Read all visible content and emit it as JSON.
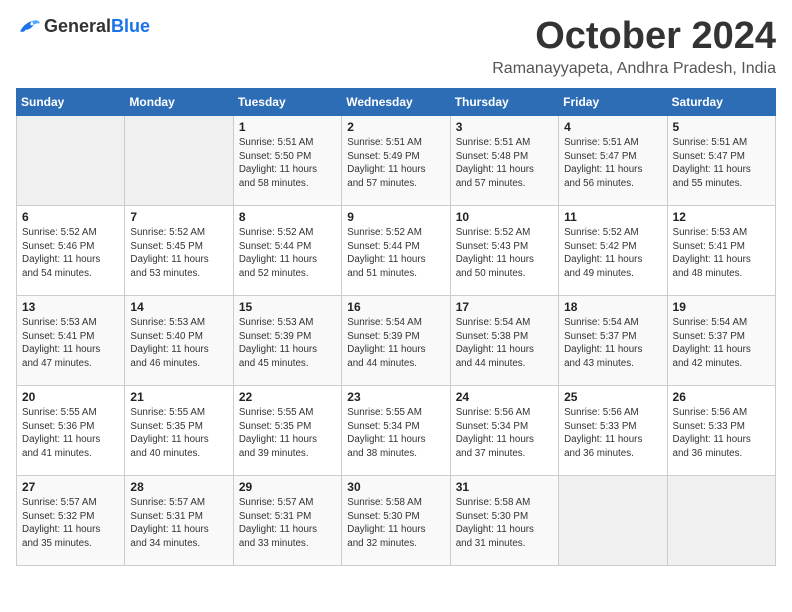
{
  "logo": {
    "general": "General",
    "blue": "Blue"
  },
  "header": {
    "month": "October 2024",
    "location": "Ramanayyapeta, Andhra Pradesh, India"
  },
  "weekdays": [
    "Sunday",
    "Monday",
    "Tuesday",
    "Wednesday",
    "Thursday",
    "Friday",
    "Saturday"
  ],
  "weeks": [
    [
      {
        "day": "",
        "sunrise": "",
        "sunset": "",
        "daylight": ""
      },
      {
        "day": "",
        "sunrise": "",
        "sunset": "",
        "daylight": ""
      },
      {
        "day": "1",
        "sunrise": "Sunrise: 5:51 AM",
        "sunset": "Sunset: 5:50 PM",
        "daylight": "Daylight: 11 hours and 58 minutes."
      },
      {
        "day": "2",
        "sunrise": "Sunrise: 5:51 AM",
        "sunset": "Sunset: 5:49 PM",
        "daylight": "Daylight: 11 hours and 57 minutes."
      },
      {
        "day": "3",
        "sunrise": "Sunrise: 5:51 AM",
        "sunset": "Sunset: 5:48 PM",
        "daylight": "Daylight: 11 hours and 57 minutes."
      },
      {
        "day": "4",
        "sunrise": "Sunrise: 5:51 AM",
        "sunset": "Sunset: 5:47 PM",
        "daylight": "Daylight: 11 hours and 56 minutes."
      },
      {
        "day": "5",
        "sunrise": "Sunrise: 5:51 AM",
        "sunset": "Sunset: 5:47 PM",
        "daylight": "Daylight: 11 hours and 55 minutes."
      }
    ],
    [
      {
        "day": "6",
        "sunrise": "Sunrise: 5:52 AM",
        "sunset": "Sunset: 5:46 PM",
        "daylight": "Daylight: 11 hours and 54 minutes."
      },
      {
        "day": "7",
        "sunrise": "Sunrise: 5:52 AM",
        "sunset": "Sunset: 5:45 PM",
        "daylight": "Daylight: 11 hours and 53 minutes."
      },
      {
        "day": "8",
        "sunrise": "Sunrise: 5:52 AM",
        "sunset": "Sunset: 5:44 PM",
        "daylight": "Daylight: 11 hours and 52 minutes."
      },
      {
        "day": "9",
        "sunrise": "Sunrise: 5:52 AM",
        "sunset": "Sunset: 5:44 PM",
        "daylight": "Daylight: 11 hours and 51 minutes."
      },
      {
        "day": "10",
        "sunrise": "Sunrise: 5:52 AM",
        "sunset": "Sunset: 5:43 PM",
        "daylight": "Daylight: 11 hours and 50 minutes."
      },
      {
        "day": "11",
        "sunrise": "Sunrise: 5:52 AM",
        "sunset": "Sunset: 5:42 PM",
        "daylight": "Daylight: 11 hours and 49 minutes."
      },
      {
        "day": "12",
        "sunrise": "Sunrise: 5:53 AM",
        "sunset": "Sunset: 5:41 PM",
        "daylight": "Daylight: 11 hours and 48 minutes."
      }
    ],
    [
      {
        "day": "13",
        "sunrise": "Sunrise: 5:53 AM",
        "sunset": "Sunset: 5:41 PM",
        "daylight": "Daylight: 11 hours and 47 minutes."
      },
      {
        "day": "14",
        "sunrise": "Sunrise: 5:53 AM",
        "sunset": "Sunset: 5:40 PM",
        "daylight": "Daylight: 11 hours and 46 minutes."
      },
      {
        "day": "15",
        "sunrise": "Sunrise: 5:53 AM",
        "sunset": "Sunset: 5:39 PM",
        "daylight": "Daylight: 11 hours and 45 minutes."
      },
      {
        "day": "16",
        "sunrise": "Sunrise: 5:54 AM",
        "sunset": "Sunset: 5:39 PM",
        "daylight": "Daylight: 11 hours and 44 minutes."
      },
      {
        "day": "17",
        "sunrise": "Sunrise: 5:54 AM",
        "sunset": "Sunset: 5:38 PM",
        "daylight": "Daylight: 11 hours and 44 minutes."
      },
      {
        "day": "18",
        "sunrise": "Sunrise: 5:54 AM",
        "sunset": "Sunset: 5:37 PM",
        "daylight": "Daylight: 11 hours and 43 minutes."
      },
      {
        "day": "19",
        "sunrise": "Sunrise: 5:54 AM",
        "sunset": "Sunset: 5:37 PM",
        "daylight": "Daylight: 11 hours and 42 minutes."
      }
    ],
    [
      {
        "day": "20",
        "sunrise": "Sunrise: 5:55 AM",
        "sunset": "Sunset: 5:36 PM",
        "daylight": "Daylight: 11 hours and 41 minutes."
      },
      {
        "day": "21",
        "sunrise": "Sunrise: 5:55 AM",
        "sunset": "Sunset: 5:35 PM",
        "daylight": "Daylight: 11 hours and 40 minutes."
      },
      {
        "day": "22",
        "sunrise": "Sunrise: 5:55 AM",
        "sunset": "Sunset: 5:35 PM",
        "daylight": "Daylight: 11 hours and 39 minutes."
      },
      {
        "day": "23",
        "sunrise": "Sunrise: 5:55 AM",
        "sunset": "Sunset: 5:34 PM",
        "daylight": "Daylight: 11 hours and 38 minutes."
      },
      {
        "day": "24",
        "sunrise": "Sunrise: 5:56 AM",
        "sunset": "Sunset: 5:34 PM",
        "daylight": "Daylight: 11 hours and 37 minutes."
      },
      {
        "day": "25",
        "sunrise": "Sunrise: 5:56 AM",
        "sunset": "Sunset: 5:33 PM",
        "daylight": "Daylight: 11 hours and 36 minutes."
      },
      {
        "day": "26",
        "sunrise": "Sunrise: 5:56 AM",
        "sunset": "Sunset: 5:33 PM",
        "daylight": "Daylight: 11 hours and 36 minutes."
      }
    ],
    [
      {
        "day": "27",
        "sunrise": "Sunrise: 5:57 AM",
        "sunset": "Sunset: 5:32 PM",
        "daylight": "Daylight: 11 hours and 35 minutes."
      },
      {
        "day": "28",
        "sunrise": "Sunrise: 5:57 AM",
        "sunset": "Sunset: 5:31 PM",
        "daylight": "Daylight: 11 hours and 34 minutes."
      },
      {
        "day": "29",
        "sunrise": "Sunrise: 5:57 AM",
        "sunset": "Sunset: 5:31 PM",
        "daylight": "Daylight: 11 hours and 33 minutes."
      },
      {
        "day": "30",
        "sunrise": "Sunrise: 5:58 AM",
        "sunset": "Sunset: 5:30 PM",
        "daylight": "Daylight: 11 hours and 32 minutes."
      },
      {
        "day": "31",
        "sunrise": "Sunrise: 5:58 AM",
        "sunset": "Sunset: 5:30 PM",
        "daylight": "Daylight: 11 hours and 31 minutes."
      },
      {
        "day": "",
        "sunrise": "",
        "sunset": "",
        "daylight": ""
      },
      {
        "day": "",
        "sunrise": "",
        "sunset": "",
        "daylight": ""
      }
    ]
  ]
}
